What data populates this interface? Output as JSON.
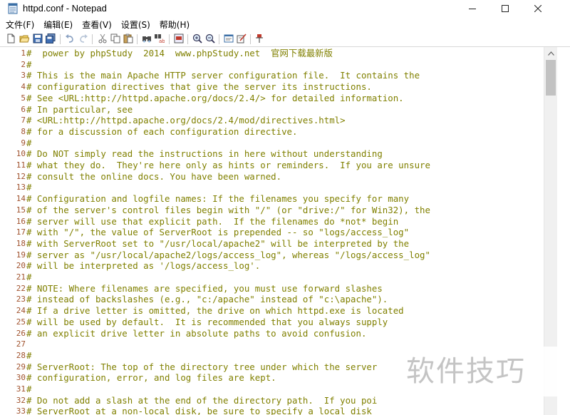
{
  "window": {
    "title": "httpd.conf - Notepad"
  },
  "menu": {
    "items": [
      "文件(F)",
      "编辑(E)",
      "查看(V)",
      "设置(S)",
      "帮助(H)"
    ]
  },
  "toolbar": {
    "icons": [
      "new-file-icon",
      "open-file-icon",
      "save-icon",
      "save-all-icon",
      "undo-icon",
      "redo-icon",
      "cut-icon",
      "copy-icon",
      "paste-icon",
      "find-icon",
      "replace-icon",
      "goto-icon",
      "zoom-in-icon",
      "zoom-out-icon",
      "word-wrap-icon",
      "scheme-icon",
      "pin-icon"
    ]
  },
  "editor": {
    "lines": [
      {
        "n": "1",
        "text": "#  power by phpStudy  2014  www.phpStudy.net  官网下载最新版"
      },
      {
        "n": "2",
        "text": "#"
      },
      {
        "n": "3",
        "text": "# This is the main Apache HTTP server configuration file.  It contains the"
      },
      {
        "n": "4",
        "text": "# configuration directives that give the server its instructions."
      },
      {
        "n": "5",
        "text": "# See <URL:http://httpd.apache.org/docs/2.4/> for detailed information."
      },
      {
        "n": "6",
        "text": "# In particular, see"
      },
      {
        "n": "7",
        "text": "# <URL:http://httpd.apache.org/docs/2.4/mod/directives.html>"
      },
      {
        "n": "8",
        "text": "# for a discussion of each configuration directive."
      },
      {
        "n": "9",
        "text": "#"
      },
      {
        "n": "10",
        "text": "# Do NOT simply read the instructions in here without understanding"
      },
      {
        "n": "11",
        "text": "# what they do.  They're here only as hints or reminders.  If you are unsure"
      },
      {
        "n": "12",
        "text": "# consult the online docs. You have been warned."
      },
      {
        "n": "13",
        "text": "#"
      },
      {
        "n": "14",
        "text": "# Configuration and logfile names: If the filenames you specify for many"
      },
      {
        "n": "15",
        "text": "# of the server's control files begin with \"/\" (or \"drive:/\" for Win32), the"
      },
      {
        "n": "16",
        "text": "# server will use that explicit path.  If the filenames do *not* begin"
      },
      {
        "n": "17",
        "text": "# with \"/\", the value of ServerRoot is prepended -- so \"logs/access_log\""
      },
      {
        "n": "18",
        "text": "# with ServerRoot set to \"/usr/local/apache2\" will be interpreted by the"
      },
      {
        "n": "19",
        "text": "# server as \"/usr/local/apache2/logs/access_log\", whereas \"/logs/access_log\""
      },
      {
        "n": "20",
        "text": "# will be interpreted as '/logs/access_log'."
      },
      {
        "n": "21",
        "text": "#"
      },
      {
        "n": "22",
        "text": "# NOTE: Where filenames are specified, you must use forward slashes"
      },
      {
        "n": "23",
        "text": "# instead of backslashes (e.g., \"c:/apache\" instead of \"c:\\apache\")."
      },
      {
        "n": "24",
        "text": "# If a drive letter is omitted, the drive on which httpd.exe is located"
      },
      {
        "n": "25",
        "text": "# will be used by default.  It is recommended that you always supply"
      },
      {
        "n": "26",
        "text": "# an explicit drive letter in absolute paths to avoid confusion."
      },
      {
        "n": "27",
        "text": ""
      },
      {
        "n": "28",
        "text": "#"
      },
      {
        "n": "29",
        "text": "# ServerRoot: The top of the directory tree under which the server"
      },
      {
        "n": "30",
        "text": "# configuration, error, and log files are kept."
      },
      {
        "n": "31",
        "text": "#"
      },
      {
        "n": "32",
        "text": "# Do not add a slash at the end of the directory path.  If you poi"
      },
      {
        "n": "33",
        "text": "# ServerRoot at a non-local disk, be sure to specify a local disk"
      }
    ]
  },
  "watermark": {
    "text": "软件技巧"
  },
  "colors": {
    "comment": "#808000",
    "line_number": "#a0522d",
    "scrollbar_thumb": "#c2c2c2"
  }
}
